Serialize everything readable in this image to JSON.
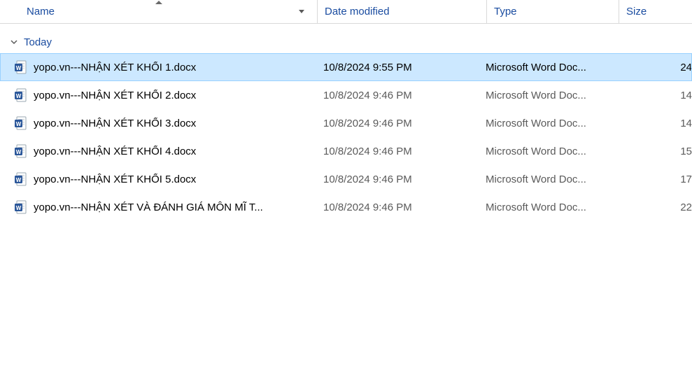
{
  "columns": {
    "name": "Name",
    "date": "Date modified",
    "type": "Type",
    "size": "Size"
  },
  "group": {
    "label": "Today"
  },
  "files": [
    {
      "name": "yopo.vn---NHẬN XÉT KHỐI 1.docx",
      "date": "10/8/2024 9:55 PM",
      "type": "Microsoft Word Doc...",
      "size": "24",
      "selected": true
    },
    {
      "name": "yopo.vn---NHẬN XÉT KHỐI 2.docx",
      "date": "10/8/2024 9:46 PM",
      "type": "Microsoft Word Doc...",
      "size": "14",
      "selected": false
    },
    {
      "name": "yopo.vn---NHẬN XÉT KHỐI 3.docx",
      "date": "10/8/2024 9:46 PM",
      "type": "Microsoft Word Doc...",
      "size": "14",
      "selected": false
    },
    {
      "name": "yopo.vn---NHẬN XÉT KHỐI 4.docx",
      "date": "10/8/2024 9:46 PM",
      "type": "Microsoft Word Doc...",
      "size": "15",
      "selected": false
    },
    {
      "name": "yopo.vn---NHẬN XÉT KHỐI 5.docx",
      "date": "10/8/2024 9:46 PM",
      "type": "Microsoft Word Doc...",
      "size": "17",
      "selected": false
    },
    {
      "name": "yopo.vn---NHẬN XÉT VÀ ĐÁNH GIÁ MÔN MĨ T...",
      "date": "10/8/2024 9:46 PM",
      "type": "Microsoft Word Doc...",
      "size": "22",
      "selected": false
    }
  ]
}
